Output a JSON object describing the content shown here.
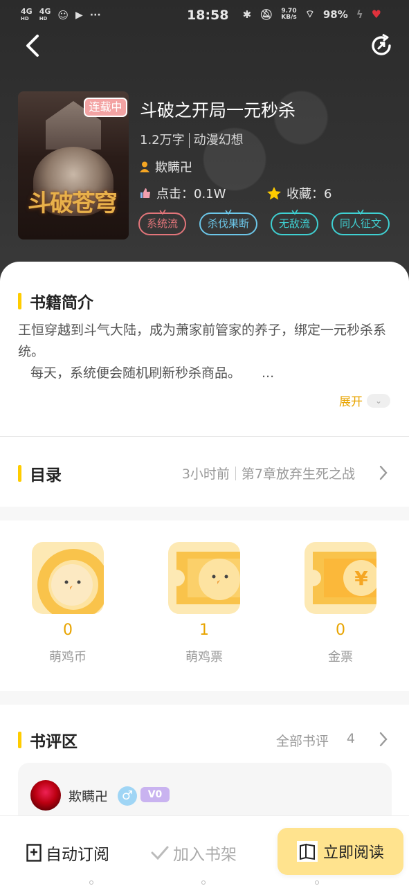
{
  "status_bar": {
    "signal1": "4G",
    "signal1_sub": "HD",
    "signal2": "4G",
    "signal2_sub": "HD",
    "time": "18:58",
    "net_speed": "9.70",
    "net_unit": "KB/s",
    "battery": "98%"
  },
  "book": {
    "serial_badge": "连载中",
    "title": "斗破之开局一元秒杀",
    "word_count": "1.2万字",
    "category": "动漫幻想",
    "author": "欺瞒卍",
    "clicks": "点击：0.1W",
    "favorites": "收藏：6",
    "tags": [
      "系统流",
      "杀伐果断",
      "无敌流",
      "同人征文"
    ],
    "cover_title": "斗破苍穹"
  },
  "intro": {
    "heading": "书籍简介",
    "line1": "王恒穿越到斗气大陆，成为萧家前管家的养子，绑定一元秒杀系统。",
    "line2": "每天，系统便会随机刷新秒杀商品。",
    "ellipsis": "...",
    "expand_label": "展开"
  },
  "toc": {
    "heading": "目录",
    "updated": "3小时前",
    "latest_chapter": "第7章放弃生死之战"
  },
  "wallet": [
    {
      "count": "0",
      "label": "萌鸡币"
    },
    {
      "count": "1",
      "label": "萌鸡票"
    },
    {
      "count": "0",
      "label": "金票"
    }
  ],
  "reviews": {
    "heading": "书评区",
    "all_label": "全部书评",
    "count": "4",
    "first_user": "欺瞒卍",
    "first_user_vip": "V0",
    "gender_symbol": "♂"
  },
  "bottom_bar": {
    "auto_subscribe": "自动订阅",
    "add_shelf": "加入书架",
    "read_now": "立即阅读"
  },
  "colors": {
    "accent_yellow": "#ffcc00",
    "expand_orange": "#e8a400",
    "read_button": "#ffe38e"
  }
}
